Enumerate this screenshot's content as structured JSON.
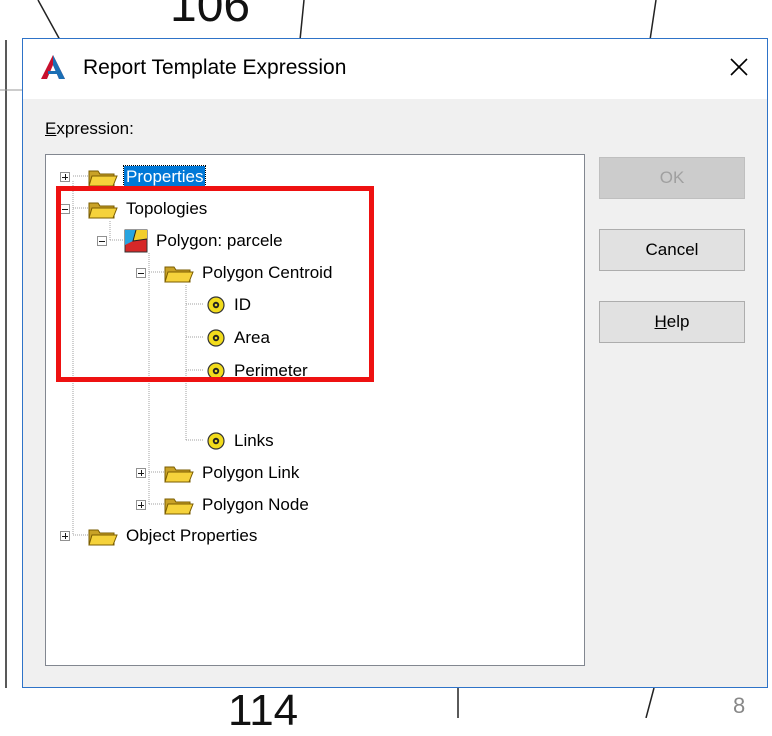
{
  "background": {
    "top_number": "106",
    "bottom_number": "114",
    "corner_number": "8"
  },
  "dialog": {
    "title": "Report Template Expression",
    "app_icon": "autocad-a-icon",
    "close_icon": "close-icon",
    "expression_label_access_key": "E",
    "expression_label_rest": "xpression:",
    "tree": [
      {
        "id": "properties",
        "label": "Properties",
        "icon": "folder-icon",
        "expander": "plus",
        "selected": true
      },
      {
        "id": "topologies",
        "label": "Topologies",
        "icon": "folder-icon",
        "expander": "minus"
      },
      {
        "id": "polygon-parcele",
        "label": "Polygon: parcele",
        "icon": "polygon-topology-icon",
        "expander": "minus"
      },
      {
        "id": "polygon-centroid",
        "label": "Polygon Centroid",
        "icon": "folder-icon",
        "expander": "minus"
      },
      {
        "id": "id",
        "label": "ID",
        "icon": "property-icon"
      },
      {
        "id": "area",
        "label": "Area",
        "icon": "property-icon"
      },
      {
        "id": "perimeter",
        "label": "Perimeter",
        "icon": "property-icon"
      },
      {
        "id": "links",
        "label": "Links",
        "icon": "property-icon"
      },
      {
        "id": "polygon-link",
        "label": "Polygon Link",
        "icon": "folder-icon",
        "expander": "plus"
      },
      {
        "id": "polygon-node",
        "label": "Polygon Node",
        "icon": "folder-icon",
        "expander": "plus"
      },
      {
        "id": "object-properties",
        "label": "Object Properties",
        "icon": "folder-icon",
        "expander": "plus"
      }
    ],
    "buttons": {
      "ok": "OK",
      "cancel": "Cancel",
      "help_access_key": "H",
      "help_rest": "elp"
    }
  },
  "colors": {
    "selection": "#0078d7",
    "highlight_box": "#ee1111",
    "dialog_border": "#2e73c8"
  }
}
